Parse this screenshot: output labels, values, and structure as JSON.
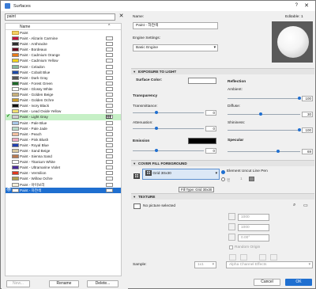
{
  "window": {
    "title": "Surfaces",
    "help": "?",
    "close": "✕"
  },
  "search": {
    "value": "paint",
    "clear": "✕"
  },
  "list": {
    "header_name": "Name",
    "header_chevron": "^",
    "folder": "Paint",
    "items": [
      {
        "label": "Paint - Alizarin Carmine",
        "color": "#c0143c"
      },
      {
        "label": "Paint - Anthracite",
        "color": "#2e2e2e"
      },
      {
        "label": "Paint - Bordeaux",
        "color": "#6a0a22"
      },
      {
        "label": "Paint - Cadmium Orange",
        "color": "#e87a1a"
      },
      {
        "label": "Paint - Cadmium Yellow",
        "color": "#f2d21a"
      },
      {
        "label": "Paint - Celadon",
        "color": "#8ab89a"
      },
      {
        "label": "Paint - Cobalt Blue",
        "color": "#1e4aa8"
      },
      {
        "label": "Paint - Dark Gray",
        "color": "#555555"
      },
      {
        "label": "Paint - Forest Green",
        "color": "#1e6a2a"
      },
      {
        "label": "Paint - Glossy White",
        "color": "#ffffff"
      },
      {
        "label": "Paint - Golden Beige",
        "color": "#c8b07a"
      },
      {
        "label": "Paint - Golden Ochre",
        "color": "#c89a2a"
      },
      {
        "label": "Paint - Ivory Black",
        "color": "#111111"
      },
      {
        "label": "Paint - Lead Oxide Yellow",
        "color": "#f0e070"
      },
      {
        "label": "Paint - Light Gray",
        "color": "#cfcfcf"
      },
      {
        "label": "Paint - Pale Blue",
        "color": "#a8c8e8"
      },
      {
        "label": "Paint - Pale Jade",
        "color": "#b8dcc8"
      },
      {
        "label": "Paint - Peach",
        "color": "#f4c0a0"
      },
      {
        "label": "Paint - Pink Blush",
        "color": "#f0a8c0"
      },
      {
        "label": "Paint - Royal Blue",
        "color": "#2040b0"
      },
      {
        "label": "Paint - Sand Beige",
        "color": "#d8c8a0"
      },
      {
        "label": "Paint - Sienna Sand",
        "color": "#b87850"
      },
      {
        "label": "Paint - Titanium White",
        "color": "#fafafa"
      },
      {
        "label": "Paint - Ultramarine Violet",
        "color": "#4a2a9a"
      },
      {
        "label": "Paint - Vermilion",
        "color": "#e03820"
      },
      {
        "label": "Paint - Willow Ochre",
        "color": "#b0a050"
      },
      {
        "label": "Paint - 아이보리",
        "color": "#f6f0dc"
      },
      {
        "label": "Paint - 하얀색",
        "color": "#ffffff"
      }
    ],
    "checkmark": "✔",
    "eye": "👁"
  },
  "buttons": {
    "new": "New...",
    "rename": "Rename",
    "delete": "Delete...",
    "cancel": "Cancel",
    "ok": "OK"
  },
  "header": {
    "name_label": "Name:",
    "editable": "Editable: 1",
    "name_value": "Paint - 하얀색",
    "engine_label": "Engine Settings:",
    "engine_value": "Basic Engine"
  },
  "light": {
    "title": "EXPOSURE TO LIGHT",
    "surface_color": "Surface Color:",
    "reflection": "Reflection",
    "ambient": "Ambient:",
    "ambient_val": "100",
    "diffuse": "Diffuse:",
    "diffuse_val": "30",
    "transparency": "Transparency",
    "transmittance": "Transmittance:",
    "transmittance_val": "0",
    "attenuation": "Attenuation:",
    "attenuation_val": "0",
    "shininess": "Shininess:",
    "shininess_val": "100",
    "emission": "Emission",
    "emission_val": "0",
    "specular": "Specular",
    "specular_val": "69"
  },
  "cover": {
    "title": "COVER FILL FOREGROUND",
    "fill_value": "Grid 30x30",
    "pen_label": "Element Uncut Line Pen",
    "pen_alt": "펜",
    "pen_num": "1",
    "tooltip": "Fill Type: Grid 30x30"
  },
  "texture": {
    "title": "TEXTURE",
    "no_picture": "No picture selected",
    "w": "1000",
    "h": "1000",
    "angle": "0.00°",
    "random": "Random Origin",
    "sample_label": "Sample:",
    "sample_value": "1x1",
    "alpha": "Alpha Channel Effects"
  }
}
